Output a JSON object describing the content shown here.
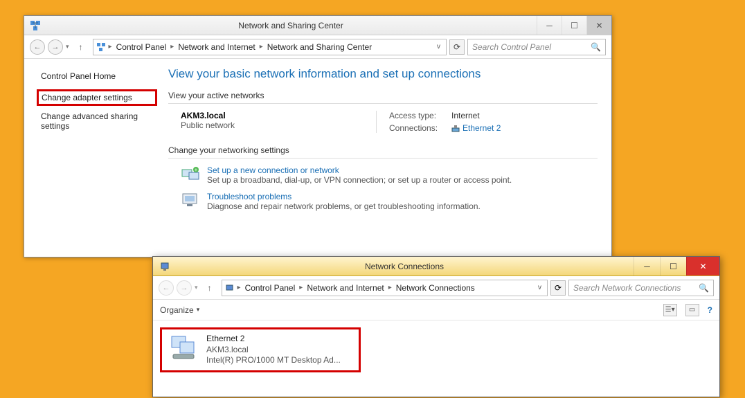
{
  "win1": {
    "title": "Network and Sharing Center",
    "nav": {
      "crumbs": [
        "Control Panel",
        "Network and Internet",
        "Network and Sharing Center"
      ]
    },
    "search_placeholder": "Search Control Panel",
    "side": {
      "home": "Control Panel Home",
      "adapter": "Change adapter settings",
      "advanced": "Change advanced sharing settings"
    },
    "headline": "View your basic network information and set up connections",
    "active_head": "View your active networks",
    "network": {
      "name": "AKM3.local",
      "type": "Public network",
      "access_label": "Access type:",
      "access_value": "Internet",
      "conn_label": "Connections:",
      "conn_value": "Ethernet 2"
    },
    "change_head": "Change your networking settings",
    "setup": {
      "link": "Set up a new connection or network",
      "desc": "Set up a broadband, dial-up, or VPN connection; or set up a router or access point."
    },
    "trouble": {
      "link": "Troubleshoot problems",
      "desc": "Diagnose and repair network problems, or get troubleshooting information."
    }
  },
  "win2": {
    "title": "Network Connections",
    "nav": {
      "crumbs": [
        "Control Panel",
        "Network and Internet",
        "Network Connections"
      ]
    },
    "search_placeholder": "Search Network Connections",
    "organize": "Organize",
    "connection": {
      "name": "Ethernet 2",
      "domain": "AKM3.local",
      "adapter": "Intel(R) PRO/1000 MT Desktop Ad..."
    }
  }
}
